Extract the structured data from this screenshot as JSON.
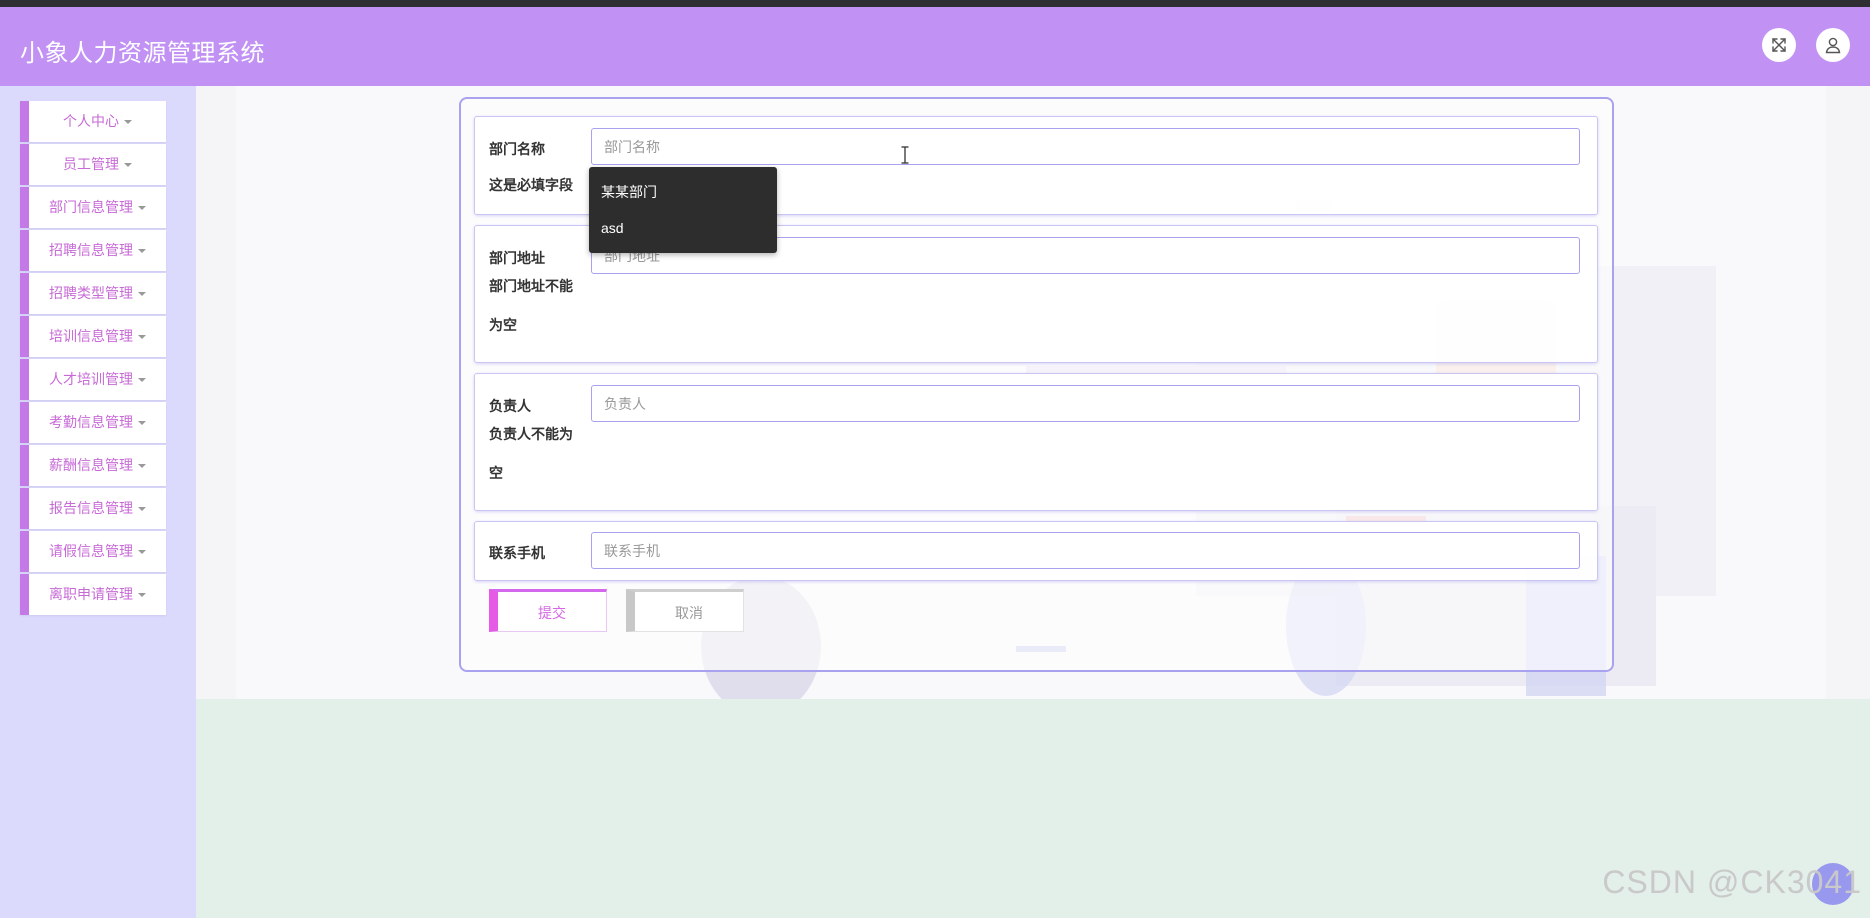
{
  "app": {
    "title": "小象人力资源管理系统"
  },
  "header": {
    "fullscreen_icon": "expand-arrows-icon",
    "user_icon": "user-icon"
  },
  "sidebar": {
    "items": [
      {
        "label": "个人中心"
      },
      {
        "label": "员工管理"
      },
      {
        "label": "部门信息管理"
      },
      {
        "label": "招聘信息管理"
      },
      {
        "label": "招聘类型管理"
      },
      {
        "label": "培训信息管理"
      },
      {
        "label": "人才培训管理"
      },
      {
        "label": "考勤信息管理"
      },
      {
        "label": "薪酬信息管理"
      },
      {
        "label": "报告信息管理"
      },
      {
        "label": "请假信息管理"
      },
      {
        "label": "离职申请管理"
      }
    ]
  },
  "form": {
    "dept_name": {
      "label": "部门名称",
      "placeholder": "部门名称",
      "value": "",
      "error": "这是必填字段"
    },
    "dept_address": {
      "label": "部门地址",
      "placeholder": "部门地址",
      "value": "",
      "error": "部门地址不能为空"
    },
    "manager": {
      "label": "负责人",
      "placeholder": "负责人",
      "value": "",
      "error": "负责人不能为空"
    },
    "phone": {
      "label": "联系手机",
      "placeholder": "联系手机",
      "value": ""
    },
    "submit_label": "提交",
    "cancel_label": "取消"
  },
  "autocomplete": {
    "options": [
      "某某部门",
      "asd"
    ]
  },
  "watermark": "CSDN @CK3041",
  "colors": {
    "header_bg": "#c192f4",
    "sidebar_bg": "#dbd9fc",
    "menu_accent": "#c47ae6",
    "menu_text": "#c76ad6",
    "form_border": "#a9a2ef",
    "submit_accent": "#e65be6",
    "dropdown_bg": "#2d2d2d"
  }
}
